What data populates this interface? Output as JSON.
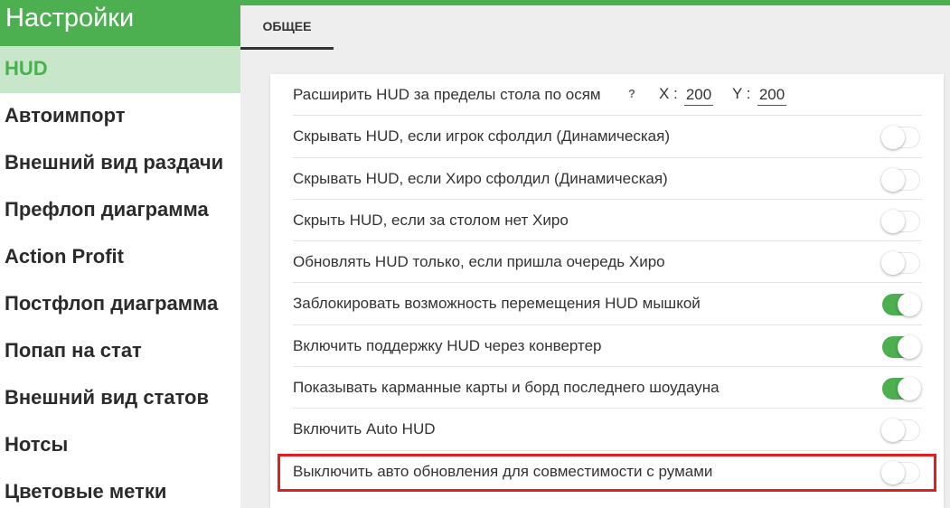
{
  "sidebar": {
    "title": "Настройки",
    "items": [
      {
        "label": "HUD",
        "active": true
      },
      {
        "label": "Автоимпорт",
        "active": false
      },
      {
        "label": "Внешний вид раздачи",
        "active": false
      },
      {
        "label": "Префлоп диаграмма",
        "active": false
      },
      {
        "label": "Action Profit",
        "active": false
      },
      {
        "label": "Постфлоп диаграмма",
        "active": false
      },
      {
        "label": "Попап на стат",
        "active": false
      },
      {
        "label": "Внешний вид статов",
        "active": false
      },
      {
        "label": "Нотсы",
        "active": false
      },
      {
        "label": "Цветовые метки",
        "active": false
      }
    ]
  },
  "tabs": {
    "general": "ОБЩЕЕ"
  },
  "settings": {
    "extend": {
      "label": "Расширить HUD за пределы стола по осям",
      "help": "?",
      "x_label": "X :",
      "x_value": "200",
      "y_label": "Y :",
      "y_value": "200"
    },
    "toggles": [
      {
        "label": "Скрывать HUD, если игрок сфолдил (Динамическая)",
        "on": false
      },
      {
        "label": "Скрывать HUD, если Хиро сфолдил (Динамическая)",
        "on": false
      },
      {
        "label": "Скрыть HUD, если за столом нет Хиро",
        "on": false
      },
      {
        "label": "Обновлять HUD только, если пришла очередь Хиро",
        "on": false
      },
      {
        "label": "Заблокировать возможность перемещения HUD мышкой",
        "on": true
      },
      {
        "label": "Включить поддержку HUD через конвертер",
        "on": true
      },
      {
        "label": "Показывать карманные карты и борд последнего шоудауна",
        "on": true
      },
      {
        "label": "Включить Auto HUD",
        "on": false
      },
      {
        "label": "Выключить авто обновления для совместимости с румами",
        "on": false
      }
    ]
  },
  "colors": {
    "accent": "#4caf50",
    "accent_light": "#c8e6c9",
    "highlight": "#e02020"
  }
}
